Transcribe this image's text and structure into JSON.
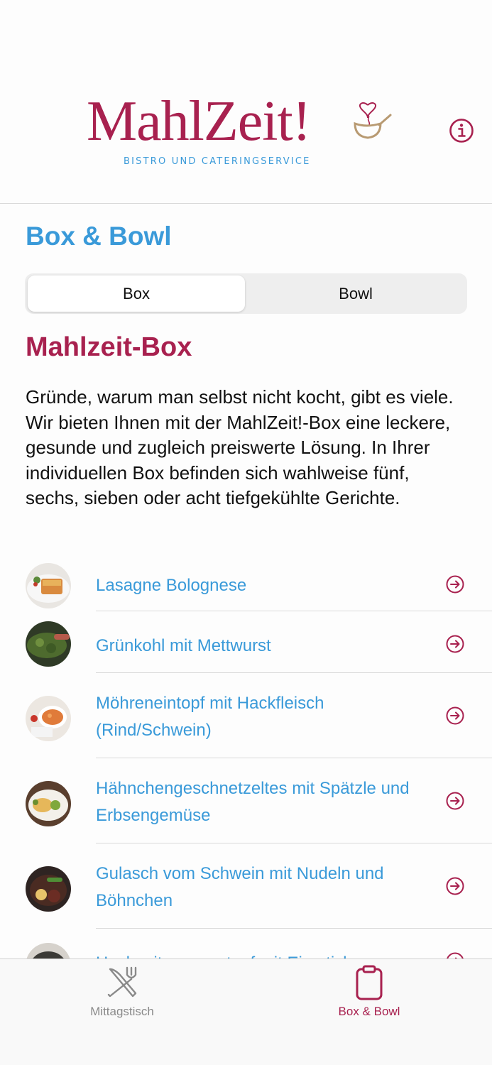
{
  "header": {
    "logo_text": "MahlZeit!",
    "logo_subtitle": "BISTRO UND CATERINGSERVICE",
    "info_icon": "info-circle-icon"
  },
  "page": {
    "title": "Box & Bowl"
  },
  "segmented": {
    "options": [
      "Box",
      "Bowl"
    ],
    "selected": "Box"
  },
  "section": {
    "title": "Mahlzeit-Box",
    "intro": "Gründe, warum man selbst nicht kocht, gibt es viele. Wir bieten Ihnen mit der MahlZeit!-Box eine leckere, gesunde und zugleich preiswerte Lösung. In Ihrer individuellen Box befinden sich wahlweise fünf, sechs, sieben oder acht tiefgekühlte Gerichte."
  },
  "dishes": [
    {
      "name": "Lasagne Bolognese"
    },
    {
      "name": "Grünkohl mit Mettwurst"
    },
    {
      "name": "Möhreneintopf mit Hackfleisch (Rind/Schwein)"
    },
    {
      "name": "Hähnchengeschnetzeltes mit Spätzle und Erbsengemüse"
    },
    {
      "name": "Gulasch vom Schwein mit Nudeln und Böhnchen"
    },
    {
      "name": "Hochzeitssuppentopf mit Eierstich"
    }
  ],
  "tabbar": {
    "tabs": [
      {
        "label": "Mittagstisch",
        "icon": "fork-knife-icon",
        "active": false
      },
      {
        "label": "Box & Bowl",
        "icon": "clipboard-icon",
        "active": true
      }
    ]
  },
  "colors": {
    "brand_red": "#a8214f",
    "brand_blue": "#3a9ad9",
    "inactive_gray": "#8a8a8a"
  }
}
